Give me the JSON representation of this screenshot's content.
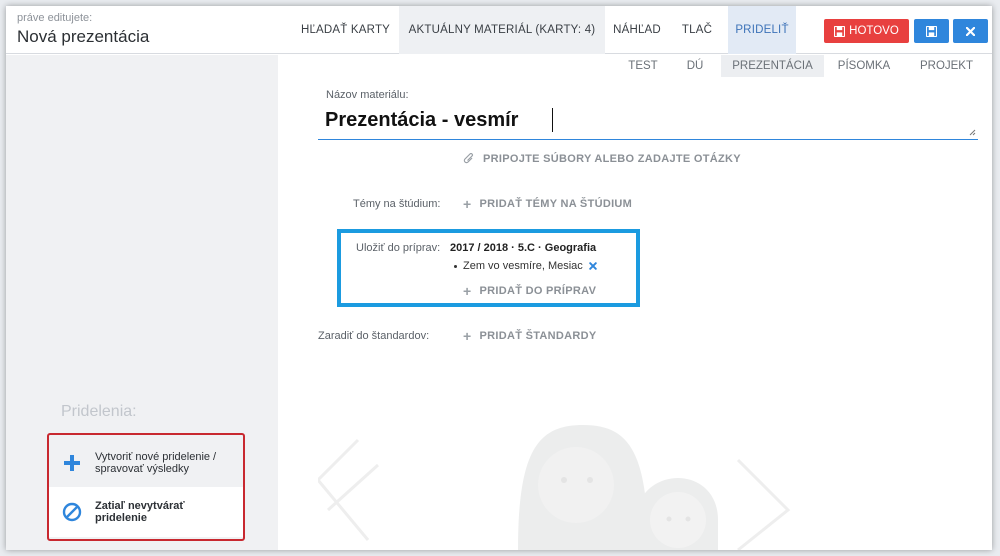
{
  "header": {
    "editing_label": "práve editujete:",
    "title": "Nová prezentácia"
  },
  "nav": {
    "tabs": [
      {
        "label": "HĽADAŤ KARTY"
      },
      {
        "label": "AKTUÁLNY MATERIÁL (KARTY: 4)"
      },
      {
        "label": "NÁHĽAD"
      },
      {
        "label": "TLAČ"
      },
      {
        "label": "PRIDELIŤ"
      }
    ],
    "done_label": "HOTOVO"
  },
  "types": {
    "tabs": [
      {
        "label": "TEST"
      },
      {
        "label": "DÚ"
      },
      {
        "label": "PREZENTÁCIA"
      },
      {
        "label": "PÍSOMKA"
      },
      {
        "label": "PROJEKT"
      }
    ],
    "active": "PREZENTÁCIA"
  },
  "form": {
    "title_label": "Názov materiálu:",
    "title_value": "Prezentácia - vesmír",
    "attach_label": "PRIPOJTE SÚBORY ALEBO ZADAJTE OTÁZKY",
    "topics_label": "Témy na štúdium:",
    "topics_action": "PRIDAŤ TÉMY NA ŠTÚDIUM",
    "save_label": "Uložiť do príprav:",
    "save_year": "2017 / 2018 · 5.C · Geografia",
    "save_item": "Zem vo vesmíre, Mesiac",
    "save_action": "PRIDAŤ DO PRÍPRAV",
    "standards_label": "Zaradiť do štandardov:",
    "standards_action": "PRIDAŤ ŠTANDARDY"
  },
  "assign": {
    "heading": "Pridelenia:",
    "option_create": "Vytvoriť nové pridelenie / spravovať výsledky",
    "option_skip": "Zatiaľ nevytvárať pridelenie"
  },
  "colors": {
    "accent": "#2f86dc",
    "danger": "#e8403f",
    "highlight": "#1b9be0",
    "annotation": "#c8282f"
  },
  "icons": [
    "save-icon",
    "close-icon",
    "paperclip-icon",
    "plus-icon",
    "remove-icon",
    "ban-icon"
  ]
}
